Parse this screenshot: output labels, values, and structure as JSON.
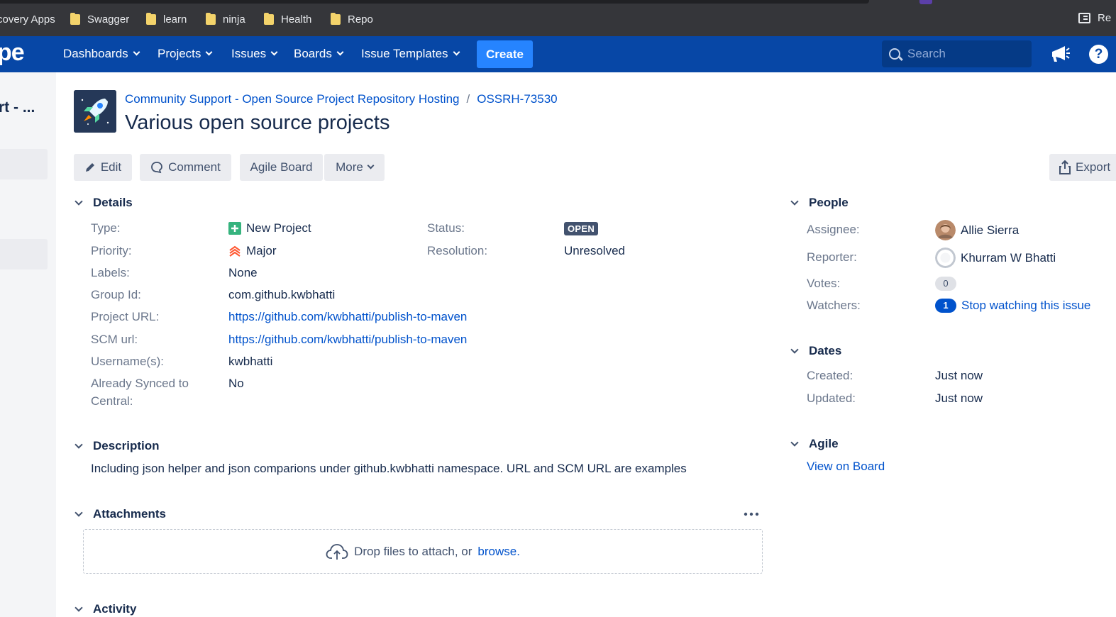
{
  "bookmarks": {
    "items": [
      "covery Apps",
      "Swagger",
      "learn",
      "ninja",
      "Health",
      "Repo"
    ],
    "reading_list": "Re"
  },
  "nav": {
    "logo": "pe",
    "items": [
      "Dashboards",
      "Projects",
      "Issues",
      "Boards",
      "Issue Templates"
    ],
    "create_label": "Create",
    "search_placeholder": "Search",
    "help": "?"
  },
  "sidebar": {
    "project_name": "rt - ..."
  },
  "issue": {
    "breadcrumb_project": "Community Support - Open Source Project Repository Hosting",
    "breadcrumb_sep": "/",
    "breadcrumb_key": "OSSRH-73530",
    "title": "Various open source projects"
  },
  "toolbar": {
    "edit": "Edit",
    "comment": "Comment",
    "agile_board": "Agile Board",
    "more": "More",
    "export": "Export"
  },
  "details": {
    "heading": "Details",
    "type_label": "Type:",
    "type_value": "New Project",
    "priority_label": "Priority:",
    "priority_value": "Major",
    "labels_label": "Labels:",
    "labels_value": "None",
    "group_label": "Group Id:",
    "group_value": "com.github.kwbhatti",
    "project_url_label": "Project URL:",
    "project_url_value": "https://github.com/kwbhatti/publish-to-maven",
    "scm_label": "SCM url:",
    "scm_value": "https://github.com/kwbhatti/publish-to-maven",
    "username_label": "Username(s):",
    "username_value": "kwbhatti",
    "synced_label_1": "Already Synced to",
    "synced_label_2": "Central:",
    "synced_value": "No",
    "status_label": "Status:",
    "status_value": "OPEN",
    "resolution_label": "Resolution:",
    "resolution_value": "Unresolved"
  },
  "description": {
    "heading": "Description",
    "text": "Including json helper and json comparions under github.kwbhatti namespace. URL and SCM URL are examples"
  },
  "attachments": {
    "heading": "Attachments",
    "drop_text": "Drop files to attach, or",
    "browse": "browse."
  },
  "activity": {
    "heading": "Activity"
  },
  "people": {
    "heading": "People",
    "assignee_label": "Assignee:",
    "assignee_value": "Allie Sierra",
    "reporter_label": "Reporter:",
    "reporter_value": "Khurram W Bhatti",
    "votes_label": "Votes:",
    "votes_value": "0",
    "watchers_label": "Watchers:",
    "watchers_count": "1",
    "watchers_action": "Stop watching this issue"
  },
  "dates": {
    "heading": "Dates",
    "created_label": "Created:",
    "created_value": "Just now",
    "updated_label": "Updated:",
    "updated_value": "Just now"
  },
  "agile": {
    "heading": "Agile",
    "view_on_board": "View on Board"
  },
  "colors": {
    "nav": "#0747a6",
    "create": "#2684ff",
    "link": "#0052cc"
  }
}
